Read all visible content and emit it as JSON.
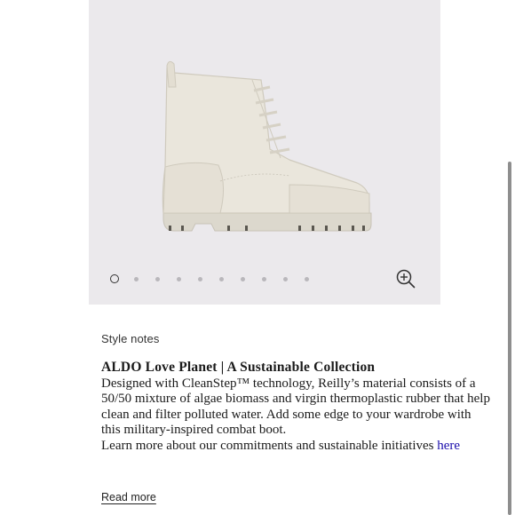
{
  "gallery": {
    "image_alt": "white lace-up combat boot",
    "slide_count": 10,
    "active_slide": 1,
    "zoom_icon": "zoom-in-icon"
  },
  "style_notes": {
    "section_label": "Style notes",
    "heading": "ALDO Love Planet | A Sustainable Collection",
    "description": "Designed with CleanStep™ technology, Reilly’s material consists of a 50/50 mixture of algae biomass and virgin thermoplastic rubber that help clean and filter polluted water. Add some edge to your wardrobe with this military-inspired combat boot.",
    "commitments_text": "Learn more about our commitments and sustainable initiatives",
    "commitments_link": "here",
    "read_more": "Read more"
  },
  "colors": {
    "gallery_bg": "#ebe9ec",
    "boot": "#eae6dc",
    "link": "#1a0dab"
  }
}
